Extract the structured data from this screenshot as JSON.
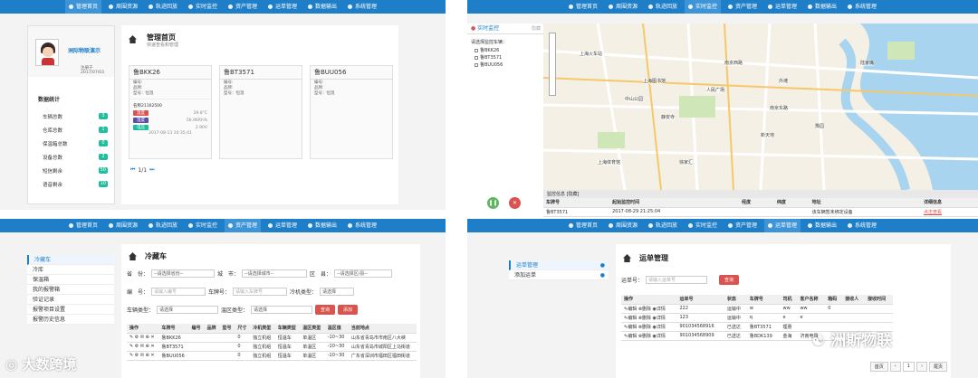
{
  "nav": [
    "管理首页",
    "周围资源",
    "轨迹回放",
    "实时监控",
    "资产管理",
    "运单管理",
    "数据输出",
    "系统管理"
  ],
  "p1": {
    "user_name": "洲际物联演示",
    "user_date": "注册于 2017/07/03",
    "stats_title": "数据统计",
    "stats": [
      {
        "label": "车辆总数",
        "value": "3"
      },
      {
        "label": "仓库总数",
        "value": "1"
      },
      {
        "label": "保温箱总数",
        "value": "0"
      },
      {
        "label": "设备总数",
        "value": "2"
      },
      {
        "label": "短信剩余",
        "value": "50"
      },
      {
        "label": "语音剩余",
        "value": "10"
      }
    ],
    "title": "管理首页",
    "subtitle": "快速查看和管理",
    "vehicles": [
      {
        "plate": "鲁BKK26",
        "fields": [
          "编号:",
          "品牌:",
          "型号：恒温"
        ],
        "device": "名称21162500",
        "temp": "29.8°C",
        "hum": "56.96Rh%",
        "volt": "2.90V",
        "time": "2017-08-13 10:35:41",
        "labels": [
          "温度",
          "湿度",
          "电压"
        ]
      },
      {
        "plate": "鲁BT3571",
        "fields": [
          "编号:",
          "品牌:",
          "型号：恒温"
        ]
      },
      {
        "plate": "鲁BUU056",
        "fields": [
          "编号:",
          "品牌:",
          "型号：恒温"
        ]
      }
    ],
    "pager": "1/1"
  },
  "p2": {
    "title": "实时监控",
    "hide": "隐藏",
    "choose": "请选择监控车辆：",
    "vehicles": [
      "鲁BKK26",
      "鲁BT3571",
      "鲁BUU056"
    ],
    "map_labels": [
      "上海火车站",
      "人民广场",
      "中山公园",
      "静安寺",
      "外滩",
      "陆家嘴",
      "新天地",
      "徐家汇",
      "上海图书馆",
      "豫园",
      "南京西路",
      "南京东路",
      "上海体育馆"
    ],
    "info_title": "监控信息 [隐藏]",
    "info_headers": [
      "车牌号",
      "起始监控时间",
      "经度",
      "纬度",
      "地址",
      "详细信息"
    ],
    "info_row": [
      "鲁BT3571",
      "2017-08-29 21:25:04",
      "",
      "",
      "该车辆暂未绑定设备",
      "点击查看"
    ]
  },
  "p3": {
    "side": [
      "冷藏车",
      "冷库",
      "保温箱",
      "我的报警箱",
      "验证记录",
      "报警项目设置",
      "报警历史信息"
    ],
    "title": "冷藏车",
    "f_province": "省　份：",
    "s_province": "--请选择省份--",
    "f_city": "城　市：",
    "s_city": "--请选择城市--",
    "f_area": "区　县：",
    "s_area": "--请选择区/县--",
    "f_no": "编　号：",
    "s_no": "请输入编号",
    "f_plate": "车牌号：",
    "s_plate": "请输入车牌号",
    "f_cold": "冷机类型：",
    "s_cold": "请选择",
    "f_type": "车辆类型：",
    "s_type": "请选择",
    "f_temp": "温区类型：",
    "s_temp": "请选择",
    "btn_search": "查询",
    "btn_add": "添加",
    "headers": [
      "操作",
      "车牌号",
      "编号",
      "品牌",
      "型号",
      "尺寸",
      "冷机类型",
      "车辆类型",
      "温区类型",
      "温区值",
      "当前地点"
    ],
    "rows": [
      [
        "✎ ⚙ ✉ ⊕ ✕",
        "鲁BKK26",
        "",
        "",
        "",
        "0",
        "独立机组",
        "恒温车",
        "单温区",
        "-10~30",
        "山东省青岛市市南区八大峡"
      ],
      [
        "✎ ⚙ ✉ ⊕ ✕",
        "鲁BT3571",
        "",
        "",
        "",
        "0",
        "独立机组",
        "恒温车",
        "单温区",
        "-10~30",
        "山东省青岛市城阳区上马街道"
      ],
      [
        "✎ ⚙ ✉ ⊕ ✕",
        "鲁BUU056",
        "",
        "",
        "",
        "0",
        "独立机组",
        "恒温车",
        "单温区",
        "-10~30",
        "广东省深圳市福田区福田街道"
      ]
    ]
  },
  "p4": {
    "side": [
      "运单管理",
      "添加运单"
    ],
    "title": "运单管理",
    "f_no": "运单号：",
    "s_no": "请输入运单号",
    "btn_search": "查询",
    "headers": [
      "操作",
      "运单号",
      "状态",
      "车牌号",
      "司机",
      "客户名称",
      "箱码",
      "接收人",
      "接收时间"
    ],
    "rows": [
      [
        "✎编辑 ⊗删除 ◉详情",
        "222",
        "运输中",
        "w",
        "ww",
        "ww",
        "0",
        "",
        ""
      ],
      [
        "✎编辑 ⊗删除 ◉详情",
        "123",
        "运输中",
        "q",
        "e",
        "e",
        "",
        "",
        ""
      ],
      [
        "✎编辑 ⊗删除 ◉详情",
        "901034568916",
        "已送达",
        "鲁BT3571",
        "理惠",
        "",
        "",
        "",
        ""
      ],
      [
        "✎编辑 ⊗删除 ◉详情",
        "901034568909",
        "已送达",
        "鲁BDK139",
        "金海",
        "济南电器",
        "",
        "",
        ""
      ]
    ],
    "pager": [
      "首页",
      "‹",
      "1",
      "›",
      "尾页"
    ]
  },
  "watermark_left": "大数跨境",
  "watermark_right": "洲斯物联"
}
